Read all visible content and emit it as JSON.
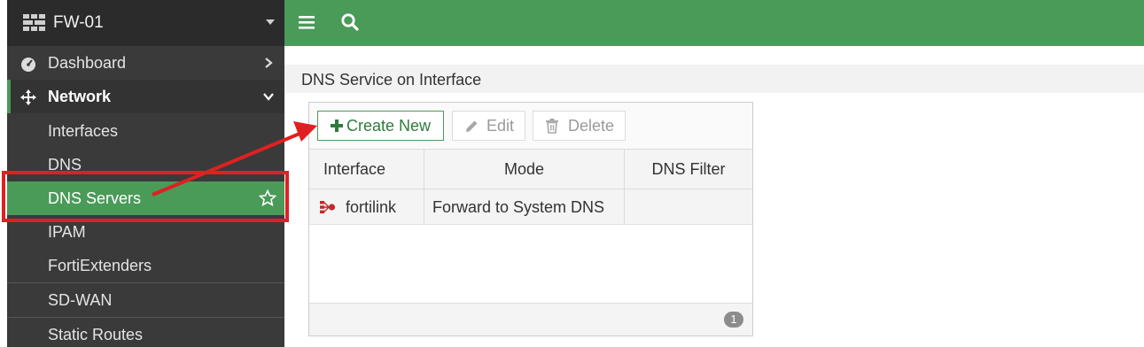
{
  "device": {
    "name": "FW-01"
  },
  "sidebar": {
    "items": [
      {
        "label": "Dashboard"
      },
      {
        "label": "Network"
      },
      {
        "label": "Interfaces"
      },
      {
        "label": "DNS"
      },
      {
        "label": "DNS Servers"
      },
      {
        "label": "IPAM"
      },
      {
        "label": "FortiExtenders"
      },
      {
        "label": "SD-WAN"
      },
      {
        "label": "Static Routes"
      }
    ]
  },
  "page": {
    "section_title": "DNS Service on Interface"
  },
  "toolbar": {
    "create_label": "Create New",
    "edit_label": "Edit",
    "delete_label": "Delete"
  },
  "table": {
    "columns": [
      "Interface",
      "Mode",
      "DNS Filter"
    ],
    "rows": [
      {
        "interface": "fortilink",
        "mode": "Forward to System DNS",
        "dns_filter": ""
      }
    ],
    "count": "1"
  },
  "colors": {
    "accent": "#4a9a58",
    "sidebar_bg": "#3a3a3a",
    "annotation": "#e02020"
  }
}
